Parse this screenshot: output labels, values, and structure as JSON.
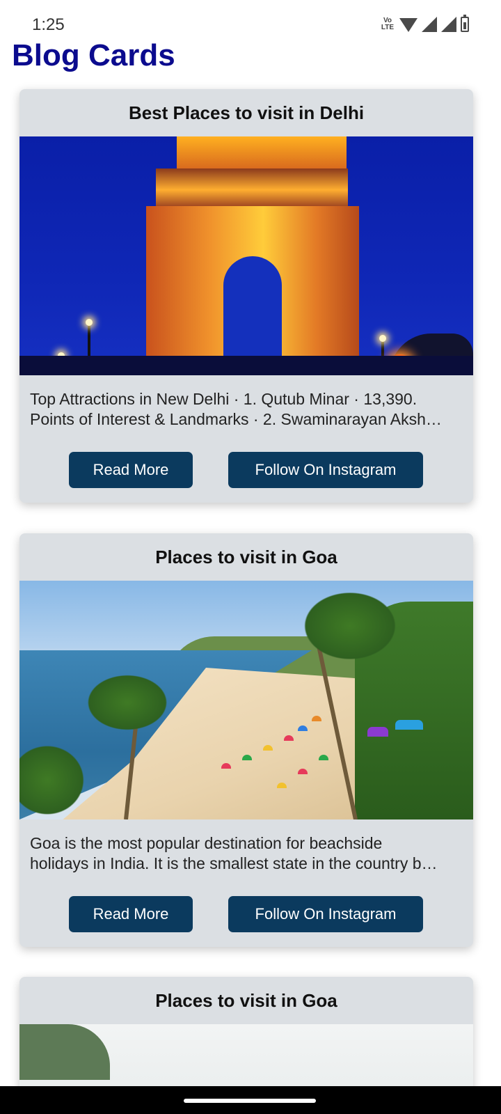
{
  "status_bar": {
    "time": "1:25",
    "volte": "Vo LTE"
  },
  "app": {
    "title": "Blog Cards",
    "title_color": "#0b0b8e"
  },
  "cards": [
    {
      "title": "Best Places to visit in Delhi",
      "image_icon": "india-gate-photo",
      "line1": "Top Attractions in New Delhi · 1. Qutub Minar · 13,390.",
      "line2": "Points of Interest & Landmarks · 2. Swaminarayan Aksh…",
      "read_more": "Read More",
      "instagram": "Follow On Instagram"
    },
    {
      "title": "Places to visit in Goa",
      "image_icon": "goa-beach-photo",
      "line1": "Goa is the most popular destination for beachside",
      "line2": "holidays in India. It is the smallest state in the country b…",
      "read_more": "Read More",
      "instagram": "Follow On Instagram"
    },
    {
      "title": "Places to visit in Goa",
      "image_icon": "goa-photo"
    }
  ],
  "colors": {
    "card_bg": "#dbdfe3",
    "button_bg": "#0b3a5e",
    "button_text": "#ffffff"
  }
}
